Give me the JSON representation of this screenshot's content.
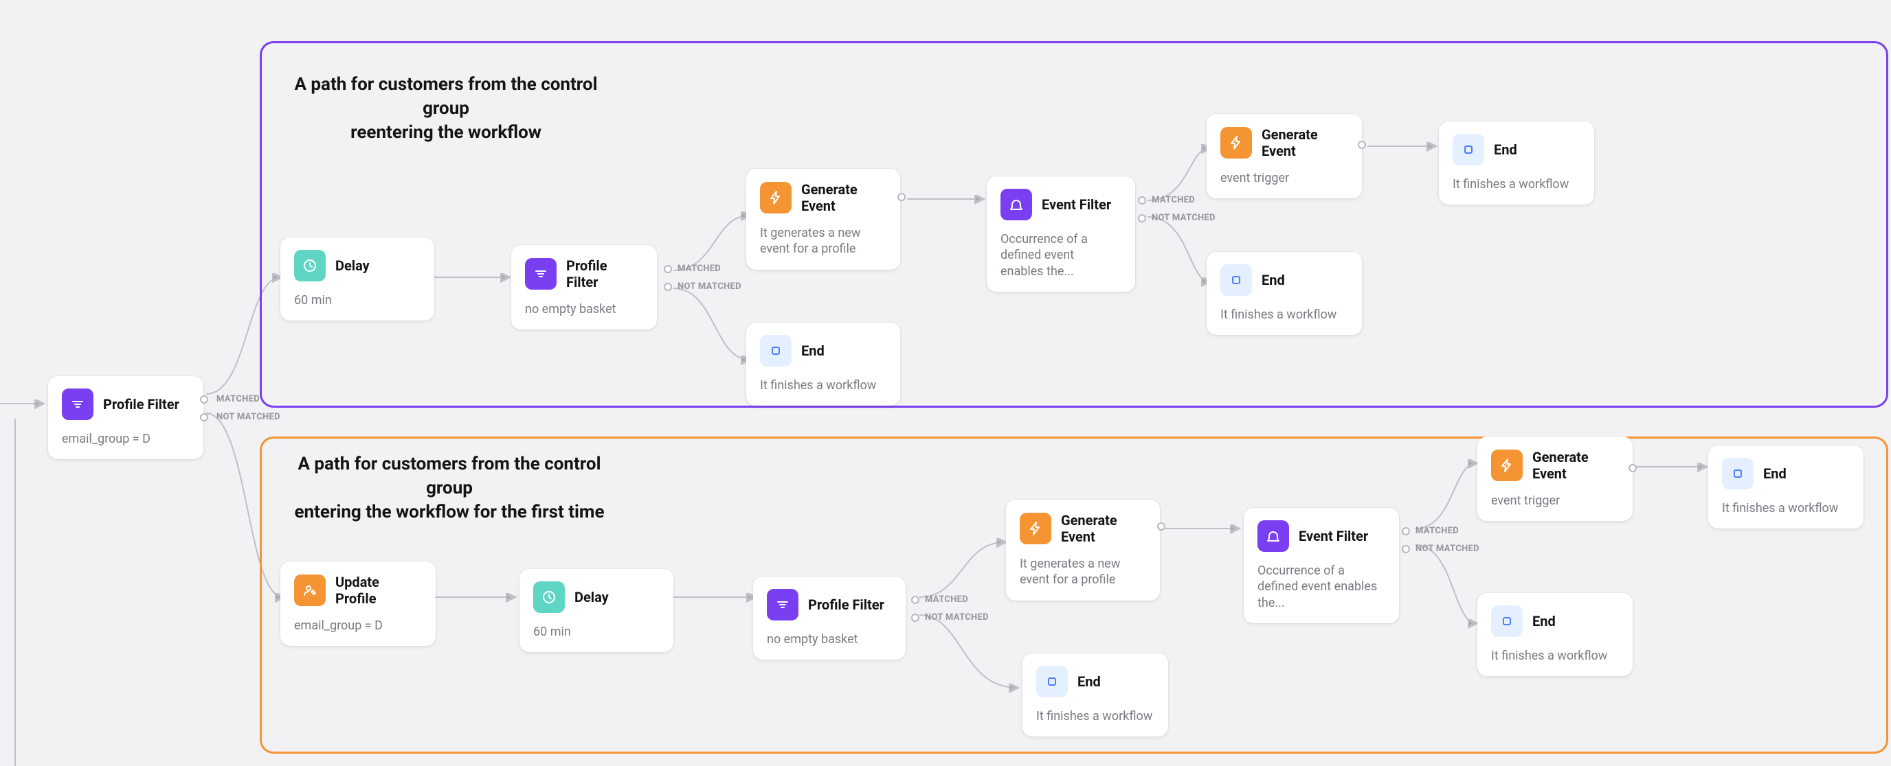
{
  "regions": {
    "top": {
      "title": "A path for customers from the control group<br>reentering the workflow"
    },
    "bottom": {
      "title": "A path for customers from the control group<br>entering the workflow for the first time"
    }
  },
  "branch_labels": {
    "matched": "MATCHED",
    "not_matched": "NOT MATCHED"
  },
  "nodes": {
    "root_filter": {
      "title": "Profile Filter",
      "sub": "email_group = D"
    },
    "top_delay": {
      "title": "Delay",
      "sub": "60 min"
    },
    "top_filter": {
      "title": "Profile Filter",
      "sub": "no empty basket"
    },
    "top_gen1": {
      "title": "Generate Event",
      "sub": "It generates a new event for a profile"
    },
    "top_end1": {
      "title": "End",
      "sub": "It finishes a workflow"
    },
    "top_eventfilter": {
      "title": "Event Filter",
      "sub": "Occurrence of a defined event enables the..."
    },
    "top_gen2": {
      "title": "Generate Event",
      "sub": "event trigger"
    },
    "top_end2": {
      "title": "End",
      "sub": "It finishes a workflow"
    },
    "top_end3": {
      "title": "End",
      "sub": "It finishes a workflow"
    },
    "bot_update": {
      "title": "Update Profile",
      "sub": "email_group = D"
    },
    "bot_delay": {
      "title": "Delay",
      "sub": "60 min"
    },
    "bot_filter": {
      "title": "Profile Filter",
      "sub": "no empty basket"
    },
    "bot_gen1": {
      "title": "Generate Event",
      "sub": "It generates a new event for a profile"
    },
    "bot_end1": {
      "title": "End",
      "sub": "It finishes a workflow"
    },
    "bot_eventfilter": {
      "title": "Event Filter",
      "sub": "Occurrence of a defined event enables the..."
    },
    "bot_gen2": {
      "title": "Generate Event",
      "sub": "event trigger"
    },
    "bot_end2": {
      "title": "End",
      "sub": "It finishes a workflow"
    },
    "bot_end3": {
      "title": "End",
      "sub": "It finishes a workflow"
    }
  }
}
